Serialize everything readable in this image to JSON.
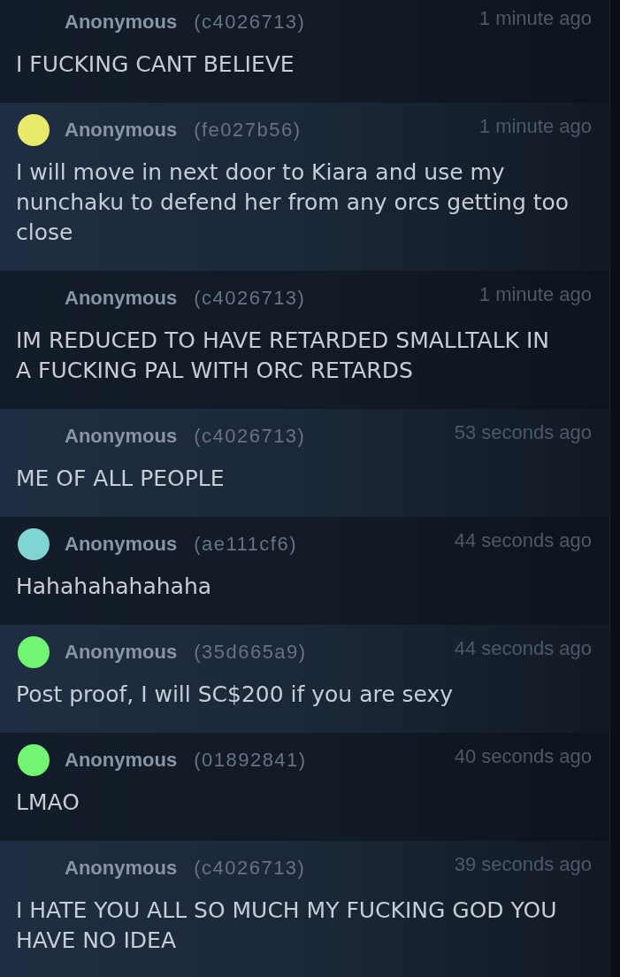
{
  "messages": [
    {
      "author": "Anonymous",
      "user_id": "(c4026713)",
      "time": "1 minute ago",
      "text": "I FUCKING CANT BELIEVE"
    },
    {
      "color": "#e9e96b",
      "author": "Anonymous",
      "user_id": "(fe027b56)",
      "time": "1 minute ago",
      "text": "I will move in next door to Kiara and use my nunchaku to defend her from any orcs getting too close"
    },
    {
      "author": "Anonymous",
      "user_id": "(c4026713)",
      "time": "1 minute ago",
      "text": "IM REDUCED TO HAVE RETARDED SMALLTALK IN A FUCKING PAL WITH ORC RETARDS"
    },
    {
      "author": "Anonymous",
      "user_id": "(c4026713)",
      "time": "53 seconds ago",
      "text": "ME OF ALL PEOPLE"
    },
    {
      "color": "#80d4d4",
      "author": "Anonymous",
      "user_id": "(ae111cf6)",
      "time": "44 seconds ago",
      "text": "Hahahahahahaha"
    },
    {
      "color": "#72f573",
      "author": "Anonymous",
      "user_id": "(35d665a9)",
      "time": "44 seconds ago",
      "text": "Post proof, I will SC$200 if you are sexy"
    },
    {
      "color": "#72f573",
      "author": "Anonymous",
      "user_id": "(01892841)",
      "time": "40 seconds ago",
      "text": "LMAO"
    },
    {
      "author": "Anonymous",
      "user_id": "(c4026713)",
      "time": "39 seconds ago",
      "text": "I HATE YOU ALL SO MUCH MY FUCKING GOD YOU HAVE NO IDEA"
    }
  ]
}
